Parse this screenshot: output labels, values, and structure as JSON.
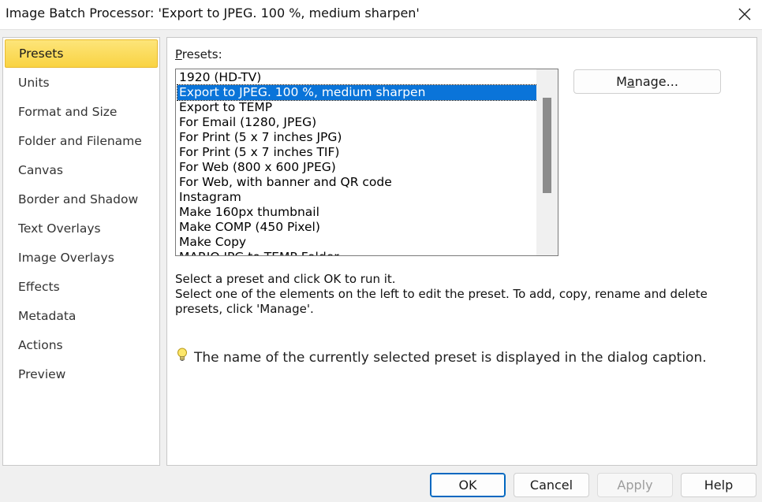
{
  "window": {
    "title": "Image Batch Processor: 'Export to JPEG. 100 %, medium sharpen'"
  },
  "nav": {
    "items": [
      {
        "label": "Presets"
      },
      {
        "label": "Units"
      },
      {
        "label": "Format and Size"
      },
      {
        "label": "Folder and Filename"
      },
      {
        "label": "Canvas"
      },
      {
        "label": "Border and Shadow"
      },
      {
        "label": "Text Overlays"
      },
      {
        "label": "Image Overlays"
      },
      {
        "label": "Effects"
      },
      {
        "label": "Metadata"
      },
      {
        "label": "Actions"
      },
      {
        "label": "Preview"
      }
    ],
    "selected": "Presets"
  },
  "presets": {
    "label_underlined": "P",
    "label_rest": "resets:",
    "items": [
      "1920 (HD-TV)",
      "Export to JPEG. 100 %, medium sharpen",
      "Export to TEMP",
      "For Email (1280, JPEG)",
      "For Print (5 x 7 inches JPG)",
      "For Print (5 x 7 inches TIF)",
      "For Web (800 x 600 JPEG)",
      "For Web, with banner and QR code",
      "Instagram",
      "Make 160px thumbnail",
      "Make COMP (450 Pixel)",
      "Make Copy",
      "MARIO JPG to TEMP Folder"
    ],
    "selected": "Export to JPEG. 100 %, medium sharpen",
    "manage_underlined_pre": "M",
    "manage_u": "a",
    "manage_rest": "nage..."
  },
  "description": {
    "line1": "Select a preset and click OK to run it.",
    "line2": "Select one of the elements on the left to edit the preset. To add, copy, rename and delete presets, click 'Manage'."
  },
  "tip": {
    "icon": "lightbulb-icon",
    "text": "The name of the currently selected preset is displayed in the dialog caption."
  },
  "buttons": {
    "ok": "OK",
    "cancel": "Cancel",
    "apply": "Apply",
    "help": "Help"
  },
  "colors": {
    "selection": "#0a74d9",
    "nav_selected": "#f9d342",
    "primary_border": "#0067c0"
  }
}
